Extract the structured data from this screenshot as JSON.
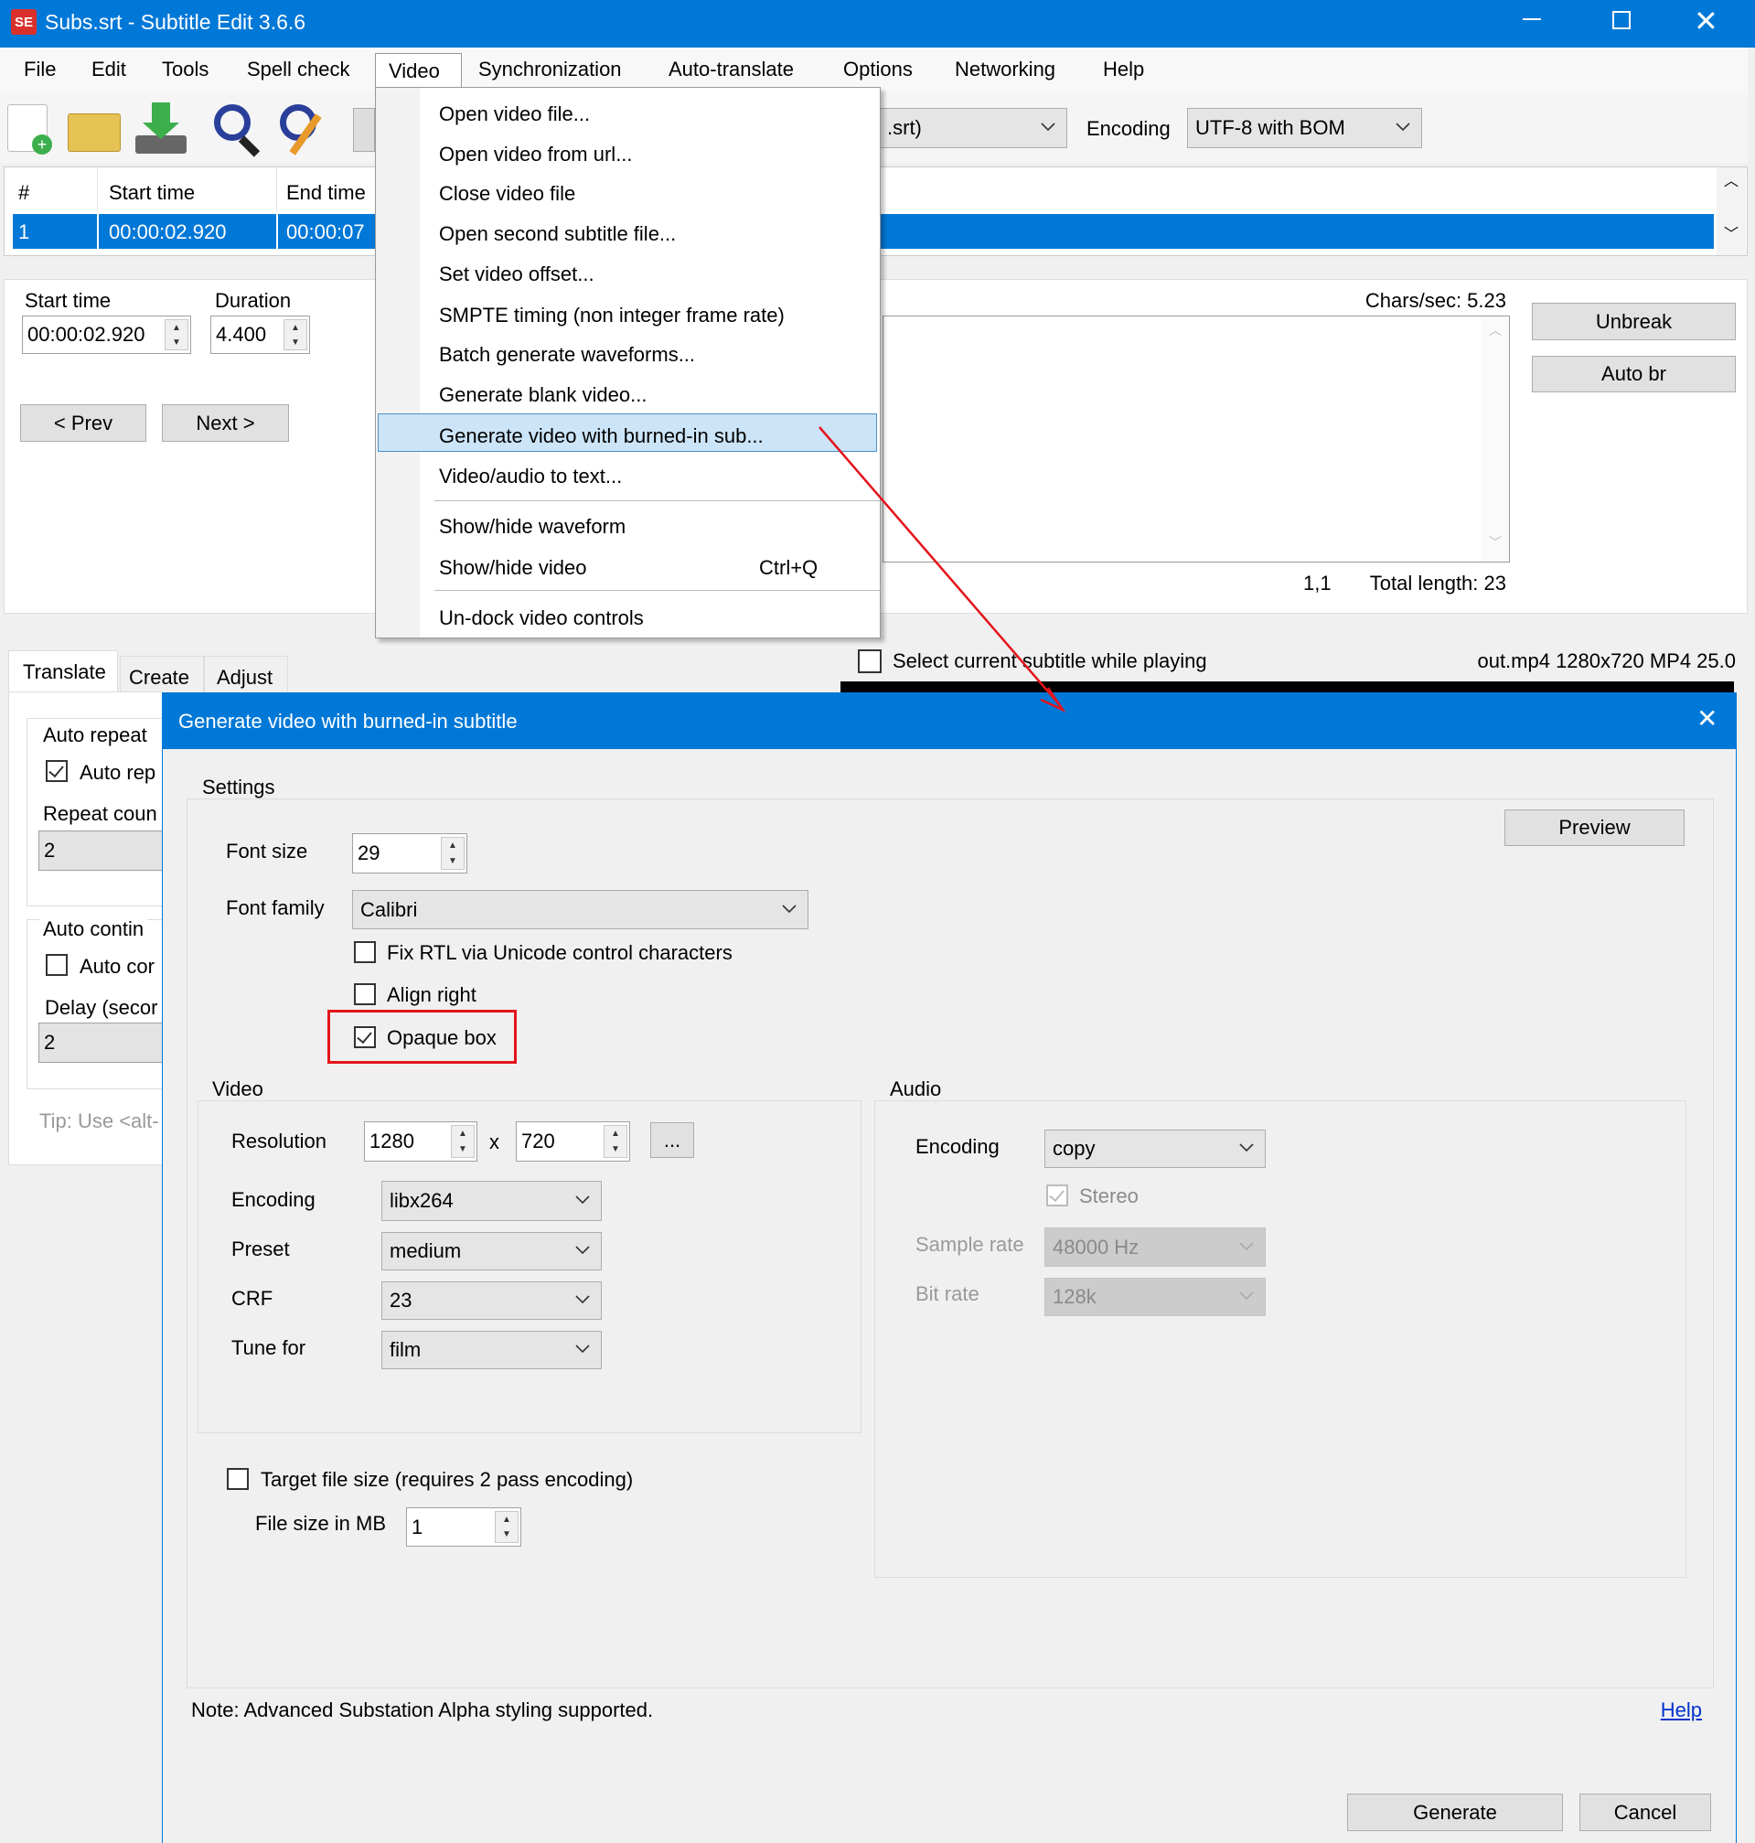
{
  "window": {
    "title": "Subs.srt - Subtitle Edit 3.6.6",
    "accent": "#0078d7"
  },
  "menubar": [
    "File",
    "Edit",
    "Tools",
    "Spell check",
    "Video",
    "Synchronization",
    "Auto-translate",
    "Options",
    "Networking",
    "Help"
  ],
  "toolbar": {
    "format_value": ".srt)",
    "encoding_label": "Encoding",
    "encoding_value": "UTF-8 with BOM"
  },
  "list": {
    "headers": [
      "#",
      "Start time",
      "End time"
    ],
    "row": [
      "1",
      "00:00:02.920",
      "00:00:07"
    ]
  },
  "edit": {
    "start_label": "Start time",
    "start_value": "00:00:02.920",
    "duration_label": "Duration",
    "duration_value": "4.400",
    "prev": "< Prev",
    "next": "Next >",
    "chars_sec": "Chars/sec: 5.23",
    "unbreak": "Unbreak",
    "auto_br": "Auto br",
    "position": "1,1",
    "total_length": "Total length: 23"
  },
  "tabs": [
    "Translate",
    "Create",
    "Adjust"
  ],
  "player": {
    "select_current": "Select current subtitle while playing",
    "video_info": "out.mp4 1280x720 MP4 25.0"
  },
  "left_panel": {
    "auto_repeat_group": "Auto repeat",
    "auto_repeat_check": "Auto rep",
    "repeat_count_label": "Repeat coun",
    "repeat_count": "2",
    "auto_continue_group": "Auto contin",
    "auto_continue_check": "Auto cor",
    "delay_label": "Delay (secor",
    "delay": "2",
    "tip": "Tip: Use <alt-"
  },
  "video_menu": {
    "items": [
      "Open video file...",
      "Open video from url...",
      "Close video file",
      "Open second subtitle file...",
      "Set video offset...",
      "SMPTE timing (non integer frame rate)",
      "Batch generate waveforms...",
      "Generate blank video...",
      "Generate video with burned-in sub...",
      "Video/audio to text...",
      "Show/hide waveform",
      "Show/hide video",
      "Un-dock video controls"
    ],
    "shortcut_show_hide_video": "Ctrl+Q"
  },
  "dialog": {
    "title": "Generate video with burned-in subtitle",
    "settings_label": "Settings",
    "font_size_label": "Font size",
    "font_size": "29",
    "font_family_label": "Font family",
    "font_family": "Calibri",
    "fix_rtl": "Fix RTL via Unicode control characters",
    "align_right": "Align right",
    "opaque_box": "Opaque box",
    "preview": "Preview",
    "video": {
      "label": "Video",
      "resolution_label": "Resolution",
      "width": "1280",
      "x": "x",
      "height": "720",
      "more": "...",
      "encoding_label": "Encoding",
      "encoding": "libx264",
      "preset_label": "Preset",
      "preset": "medium",
      "crf_label": "CRF",
      "crf": "23",
      "tune_label": "Tune for",
      "tune": "film"
    },
    "audio": {
      "label": "Audio",
      "encoding_label": "Encoding",
      "encoding": "copy",
      "stereo": "Stereo",
      "sample_rate_label": "Sample rate",
      "sample_rate": "48000 Hz",
      "bit_rate_label": "Bit rate",
      "bit_rate": "128k"
    },
    "target_file_size": "Target file size (requires 2 pass encoding)",
    "file_size_label": "File size in MB",
    "file_size": "1",
    "note": "Note: Advanced Substation Alpha styling supported.",
    "help": "Help",
    "generate": "Generate",
    "cancel": "Cancel"
  }
}
